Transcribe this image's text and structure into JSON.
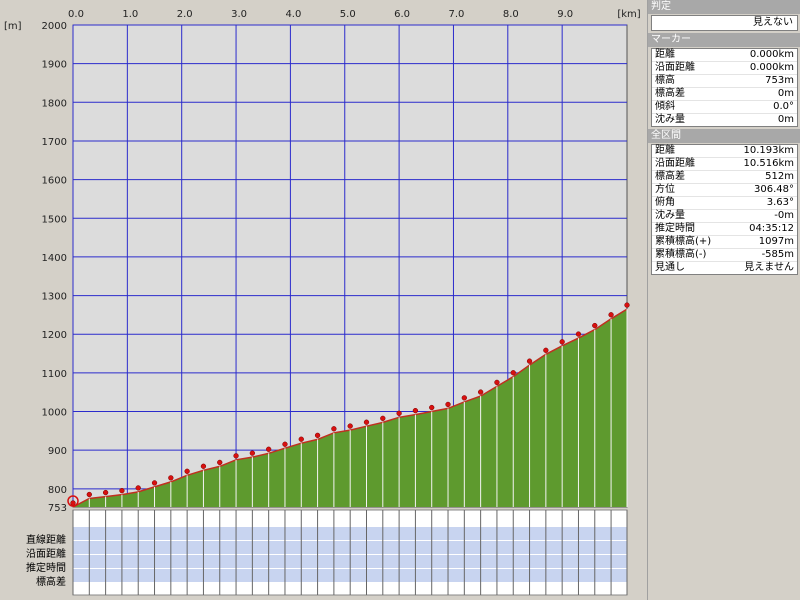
{
  "chart_data": {
    "type": "area",
    "x_unit": "[km]",
    "y_unit": "[m]",
    "xlim": [
      0,
      10.193
    ],
    "ylim": [
      753,
      2000
    ],
    "x_ticks": [
      "0.0",
      "1.0",
      "2.0",
      "3.0",
      "4.0",
      "5.0",
      "6.0",
      "7.0",
      "8.0",
      "9.0"
    ],
    "y_ticks": [
      "800",
      "900",
      "1000",
      "1100",
      "1200",
      "1300",
      "1400",
      "1500",
      "1600",
      "1700",
      "1800",
      "1900",
      "2000"
    ],
    "y_base_label": "753",
    "x_km": [
      0,
      0.3,
      0.6,
      0.9,
      1.2,
      1.5,
      1.8,
      2.1,
      2.4,
      2.7,
      3.0,
      3.3,
      3.6,
      3.9,
      4.2,
      4.5,
      4.8,
      5.1,
      5.4,
      5.7,
      6.0,
      6.3,
      6.6,
      6.9,
      7.2,
      7.5,
      7.8,
      8.1,
      8.4,
      8.7,
      9.0,
      9.3,
      9.6,
      9.9,
      10.193
    ],
    "elevation_m": [
      753,
      775,
      780,
      785,
      792,
      805,
      818,
      835,
      848,
      858,
      875,
      882,
      892,
      905,
      918,
      928,
      945,
      952,
      962,
      972,
      985,
      992,
      1000,
      1008,
      1025,
      1040,
      1065,
      1090,
      1120,
      1148,
      1170,
      1190,
      1212,
      1240,
      1265
    ],
    "color_fill": "#5e9a2e",
    "color_line": "#c03020",
    "color_plot_bg": "#dcdcdc",
    "color_grid": "#2b2bcc"
  },
  "table_rows": {
    "r1": "直線距離",
    "r2": "沿面距離",
    "r3": "推定時間",
    "r4": "標高差"
  },
  "panel": {
    "judge_title": "判定",
    "judge_value": "見えない",
    "marker_title": "マーカー",
    "marker_items": [
      {
        "k": "距離",
        "v": "0.000km"
      },
      {
        "k": "沿面距離",
        "v": "0.000km"
      },
      {
        "k": "標高",
        "v": "753m"
      },
      {
        "k": "標高差",
        "v": "0m"
      },
      {
        "k": "傾斜",
        "v": "0.0°"
      },
      {
        "k": "沈み量",
        "v": "0m"
      }
    ],
    "total_title": "全区間",
    "total_items": [
      {
        "k": "距離",
        "v": "10.193km"
      },
      {
        "k": "沿面距離",
        "v": "10.516km"
      },
      {
        "k": "標高差",
        "v": "512m"
      },
      {
        "k": "方位",
        "v": "306.48°"
      },
      {
        "k": "俯角",
        "v": "3.63°"
      },
      {
        "k": "沈み量",
        "v": "-0m"
      },
      {
        "k": "推定時間",
        "v": "04:35:12"
      },
      {
        "k": "累積標高(+)",
        "v": "1097m"
      },
      {
        "k": "累積標高(-)",
        "v": "-585m"
      },
      {
        "k": "見通し",
        "v": "見えません"
      }
    ]
  }
}
